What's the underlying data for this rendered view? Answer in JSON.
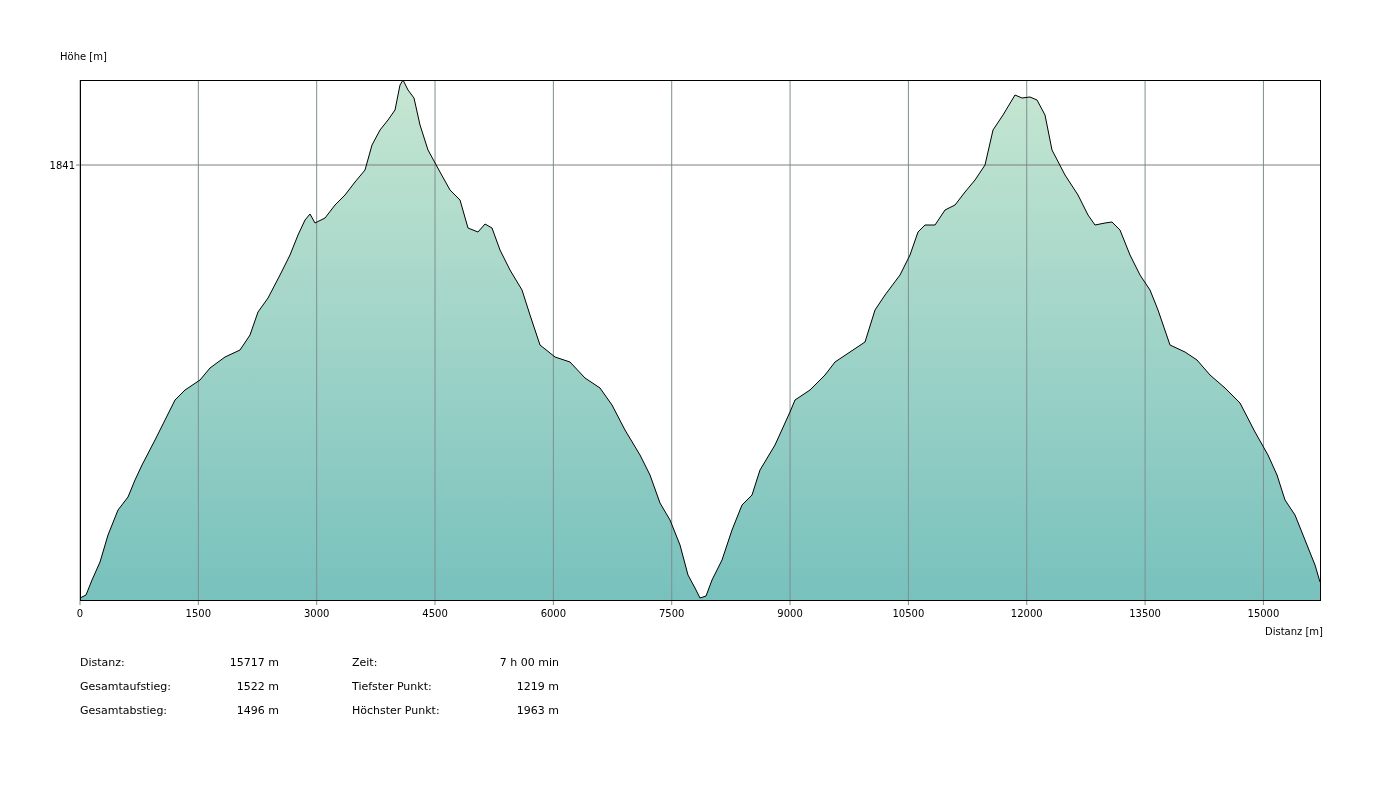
{
  "chart": {
    "y_axis_label": "Höhe [m]",
    "x_axis_label": "Distanz [m]",
    "y_ticks": [
      "1841"
    ],
    "x_ticks": [
      "0",
      "1500",
      "3000",
      "4500",
      "6000",
      "7500",
      "9000",
      "10500",
      "12000",
      "13500",
      "15000"
    ]
  },
  "stats": [
    {
      "label": "Distanz:",
      "value": "15717 m"
    },
    {
      "label": "Zeit:",
      "value": "7 h 00 min"
    },
    {
      "label": "Gesamtaufstieg:",
      "value": "1522 m"
    },
    {
      "label": "Tiefster Punkt:",
      "value": "1219 m"
    },
    {
      "label": "Gesamtabstieg:",
      "value": "1496 m"
    },
    {
      "label": "Höchster Punkt:",
      "value": "1963 m"
    }
  ]
}
